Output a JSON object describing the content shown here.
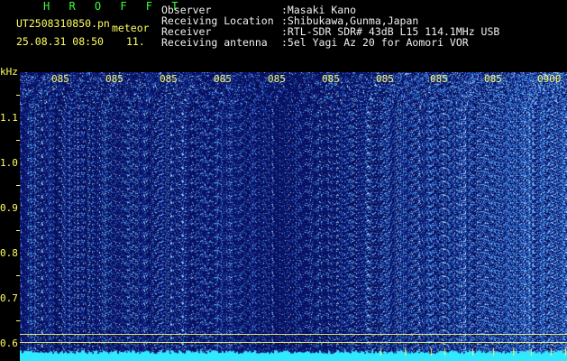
{
  "header": {
    "station": "H R O F F T",
    "filename": "UT2508310850.pn",
    "type": "meteor",
    "datetime": "25.08.31 08:50",
    "count": "11.",
    "fields": [
      {
        "label": "Observer",
        "value": ":Masaki Kano"
      },
      {
        "label": "Receiving Location",
        "value": ":Shibukawa,Gunma,Japan"
      },
      {
        "label": "Receiver",
        "value": ":RTL-SDR SDR# 43dB L15 114.1MHz USB"
      },
      {
        "label": "Receiving antenna",
        "value": ":5el Yagi Az 20 for Aomori VOR"
      }
    ]
  },
  "axis": {
    "unit": "kHz",
    "time_ticks": [
      "085",
      "085",
      "085",
      "085",
      "085",
      "085",
      "085",
      "085",
      "085",
      "0900"
    ],
    "freq_ticks": [
      "1.1",
      "1.0",
      "0.9",
      "0.8",
      "0.7",
      "0.6"
    ]
  },
  "colors": {
    "background": "#000000",
    "spectrum_base": "#0a0a6e",
    "noise": "#3c5cff",
    "signal": "#30e8ff",
    "axis": "#ffff60",
    "title": "#3cff3c"
  }
}
